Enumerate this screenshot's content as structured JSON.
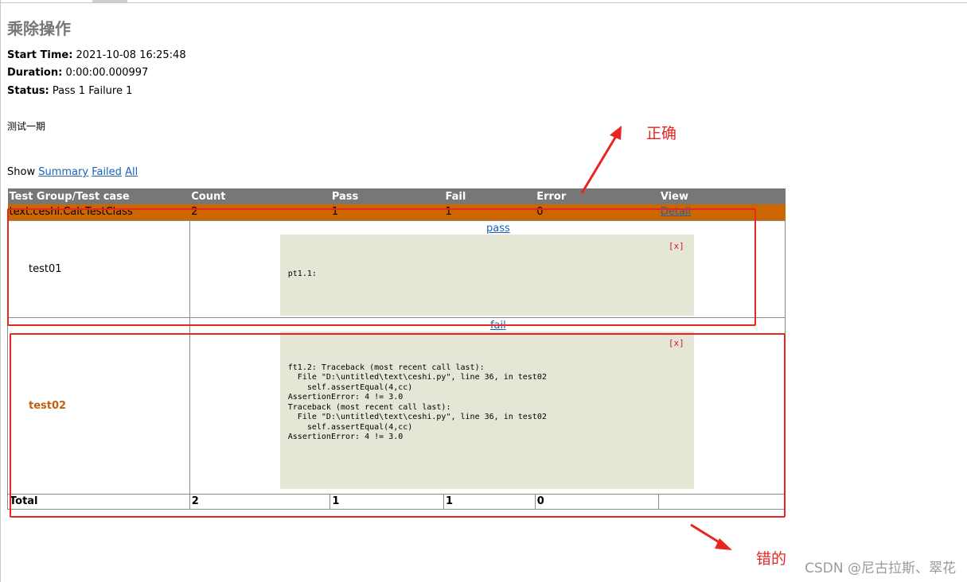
{
  "report": {
    "title": "乘除操作",
    "start_time_label": "Start Time:",
    "start_time": "2021-10-08 16:25:48",
    "duration_label": "Duration:",
    "duration": "0:00:00.000997",
    "status_label": "Status:",
    "status": "Pass 1 Failure 1",
    "description": "测试一期"
  },
  "show": {
    "label": "Show",
    "links": [
      "Summary",
      "Failed",
      "All"
    ]
  },
  "table": {
    "headers": [
      "Test Group/Test case",
      "Count",
      "Pass",
      "Fail",
      "Error",
      "View"
    ],
    "class_row": {
      "name": "text.ceshi.CalcTestClass",
      "count": "2",
      "pass": "1",
      "fail": "1",
      "error": "0",
      "view": "Detail"
    },
    "cases": [
      {
        "name": "test01",
        "status_link": "pass",
        "close": "[x]",
        "output": "pt1.1:"
      },
      {
        "name": "test02",
        "status_link": "fail",
        "close": "[x]",
        "output": "ft1.2: Traceback (most recent call last):\n  File \"D:\\untitled\\text\\ceshi.py\", line 36, in test02\n    self.assertEqual(4,cc)\nAssertionError: 4 != 3.0\nTraceback (most recent call last):\n  File \"D:\\untitled\\text\\ceshi.py\", line 36, in test02\n    self.assertEqual(4,cc)\nAssertionError: 4 != 3.0"
      }
    ],
    "total": {
      "label": "Total",
      "count": "2",
      "pass": "1",
      "fail": "1",
      "error": "0"
    }
  },
  "annotations": {
    "correct": "正确",
    "wrong": "错的",
    "color": "#e8251f"
  },
  "watermark": "CSDN @尼古拉斯、翠花",
  "colors": {
    "header_bg": "#777777",
    "class_row_bg": "#cc6600",
    "popup_bg": "#e6e6d6",
    "link": "#1a62b7",
    "failed_case_text": "#c0610e"
  }
}
